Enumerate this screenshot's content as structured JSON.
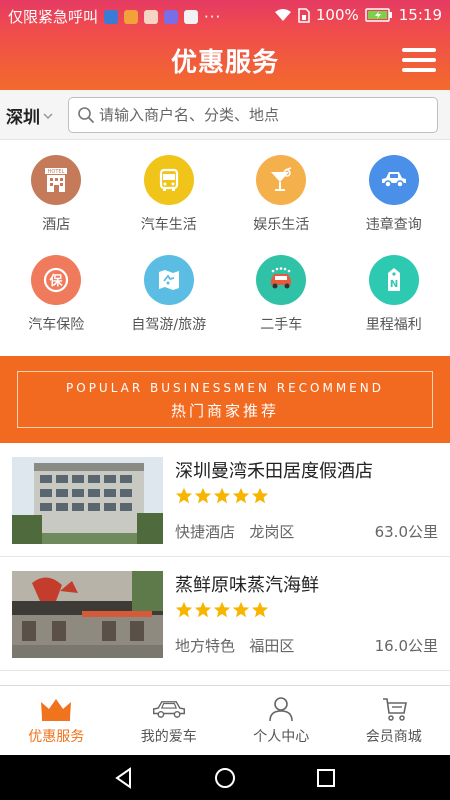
{
  "status_bar": {
    "carrier_text": "仅限紧急呼叫",
    "overflow": "···",
    "battery_percent": "100%",
    "time": "15:19"
  },
  "header": {
    "title": "优惠服务",
    "menu_icon": "hamburger-icon"
  },
  "search": {
    "city": "深圳",
    "placeholder": "请输入商户名、分类、地点",
    "value": ""
  },
  "categories": [
    {
      "label": "酒店",
      "icon": "hotel-icon",
      "color": "#c57a5a"
    },
    {
      "label": "汽车生活",
      "icon": "bus-icon",
      "color": "#f0c419"
    },
    {
      "label": "娱乐生活",
      "icon": "cocktail-icon",
      "color": "#f4b04a"
    },
    {
      "label": "违章查询",
      "icon": "car-icon",
      "color": "#4a8fe8"
    },
    {
      "label": "汽车保险",
      "icon": "insurance-icon",
      "color": "#f07a5c"
    },
    {
      "label": "自驾游/旅游",
      "icon": "map-icon",
      "color": "#5bbde4"
    },
    {
      "label": "二手车",
      "icon": "used-car-icon",
      "color": "#2fc2a6"
    },
    {
      "label": "里程福利",
      "icon": "tag-icon",
      "color": "#2ec9b1"
    }
  ],
  "banner": {
    "title_en": "POPULAR BUSINESSMEN RECOMMEND",
    "title_zh": "热门商家推荐"
  },
  "shops": [
    {
      "name": "深圳曼湾禾田居度假酒店",
      "rating": 5,
      "category": "快捷酒店",
      "district": "龙岗区",
      "distance": "63.0公里"
    },
    {
      "name": "蒸鲜原味蒸汽海鲜",
      "rating": 5,
      "category": "地方特色",
      "district": "福田区",
      "distance": "16.0公里"
    }
  ],
  "bottom_nav": [
    {
      "label": "优惠服务",
      "icon": "crown-icon",
      "active": true
    },
    {
      "label": "我的爱车",
      "icon": "car-outline-icon",
      "active": false
    },
    {
      "label": "个人中心",
      "icon": "person-icon",
      "active": false
    },
    {
      "label": "会员商城",
      "icon": "cart-icon",
      "active": false
    }
  ],
  "colors": {
    "header_top": "#e53a63",
    "header_bottom": "#f36a2c",
    "accent": "#f26a1f",
    "star": "#f7b500",
    "active_nav": "#f0731e"
  }
}
